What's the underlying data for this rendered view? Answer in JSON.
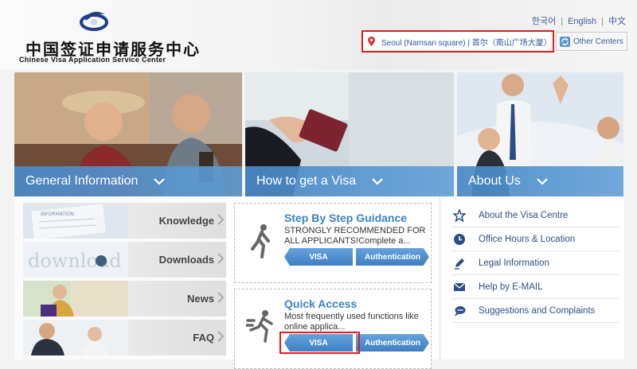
{
  "brand": {
    "name_cn": "中国签证申请服务中心",
    "name_en": "Chinese Visa Application Service Center"
  },
  "languages": [
    "한국어",
    "English",
    "中文"
  ],
  "location": {
    "current": "Seoul (Namsan square) | 首尔（南山广场大厦）",
    "other_centers": "Other Centers"
  },
  "sections": [
    {
      "title": "General Information"
    },
    {
      "title": "How to get a Visa"
    },
    {
      "title": "About Us"
    }
  ],
  "general_info": {
    "items": [
      "Knowledge",
      "Downloads",
      "News",
      "FAQ"
    ],
    "thumb_text": {
      "information": "INFORMATION",
      "download": "download"
    }
  },
  "visa": {
    "cards": [
      {
        "title": "Step By Step Guidance",
        "description": "STRONGLY RECOMMENDED FOR ALL APPLICANTS!Complete a...",
        "btn_visa": "VISA",
        "btn_auth": "Authentication"
      },
      {
        "title": "Quick Access",
        "description": "Most frequently used functions like online applica...",
        "btn_visa": "VISA",
        "btn_auth": "Authentication"
      }
    ]
  },
  "about": {
    "links": [
      {
        "label": "About the Visa Centre",
        "icon": "star-icon"
      },
      {
        "label": "Office Hours & Location",
        "icon": "clock-icon"
      },
      {
        "label": "Legal Information",
        "icon": "pen-icon"
      },
      {
        "label": "Help by E-MAIL",
        "icon": "mail-icon"
      },
      {
        "label": "Suggestions and Complaints",
        "icon": "speech-bubble-icon"
      }
    ]
  },
  "colors": {
    "accent_blue": "#4a8bc9",
    "link_blue": "#2c4f8a",
    "highlight_red": "#e21c1c",
    "title_blue": "#3b82c4"
  }
}
